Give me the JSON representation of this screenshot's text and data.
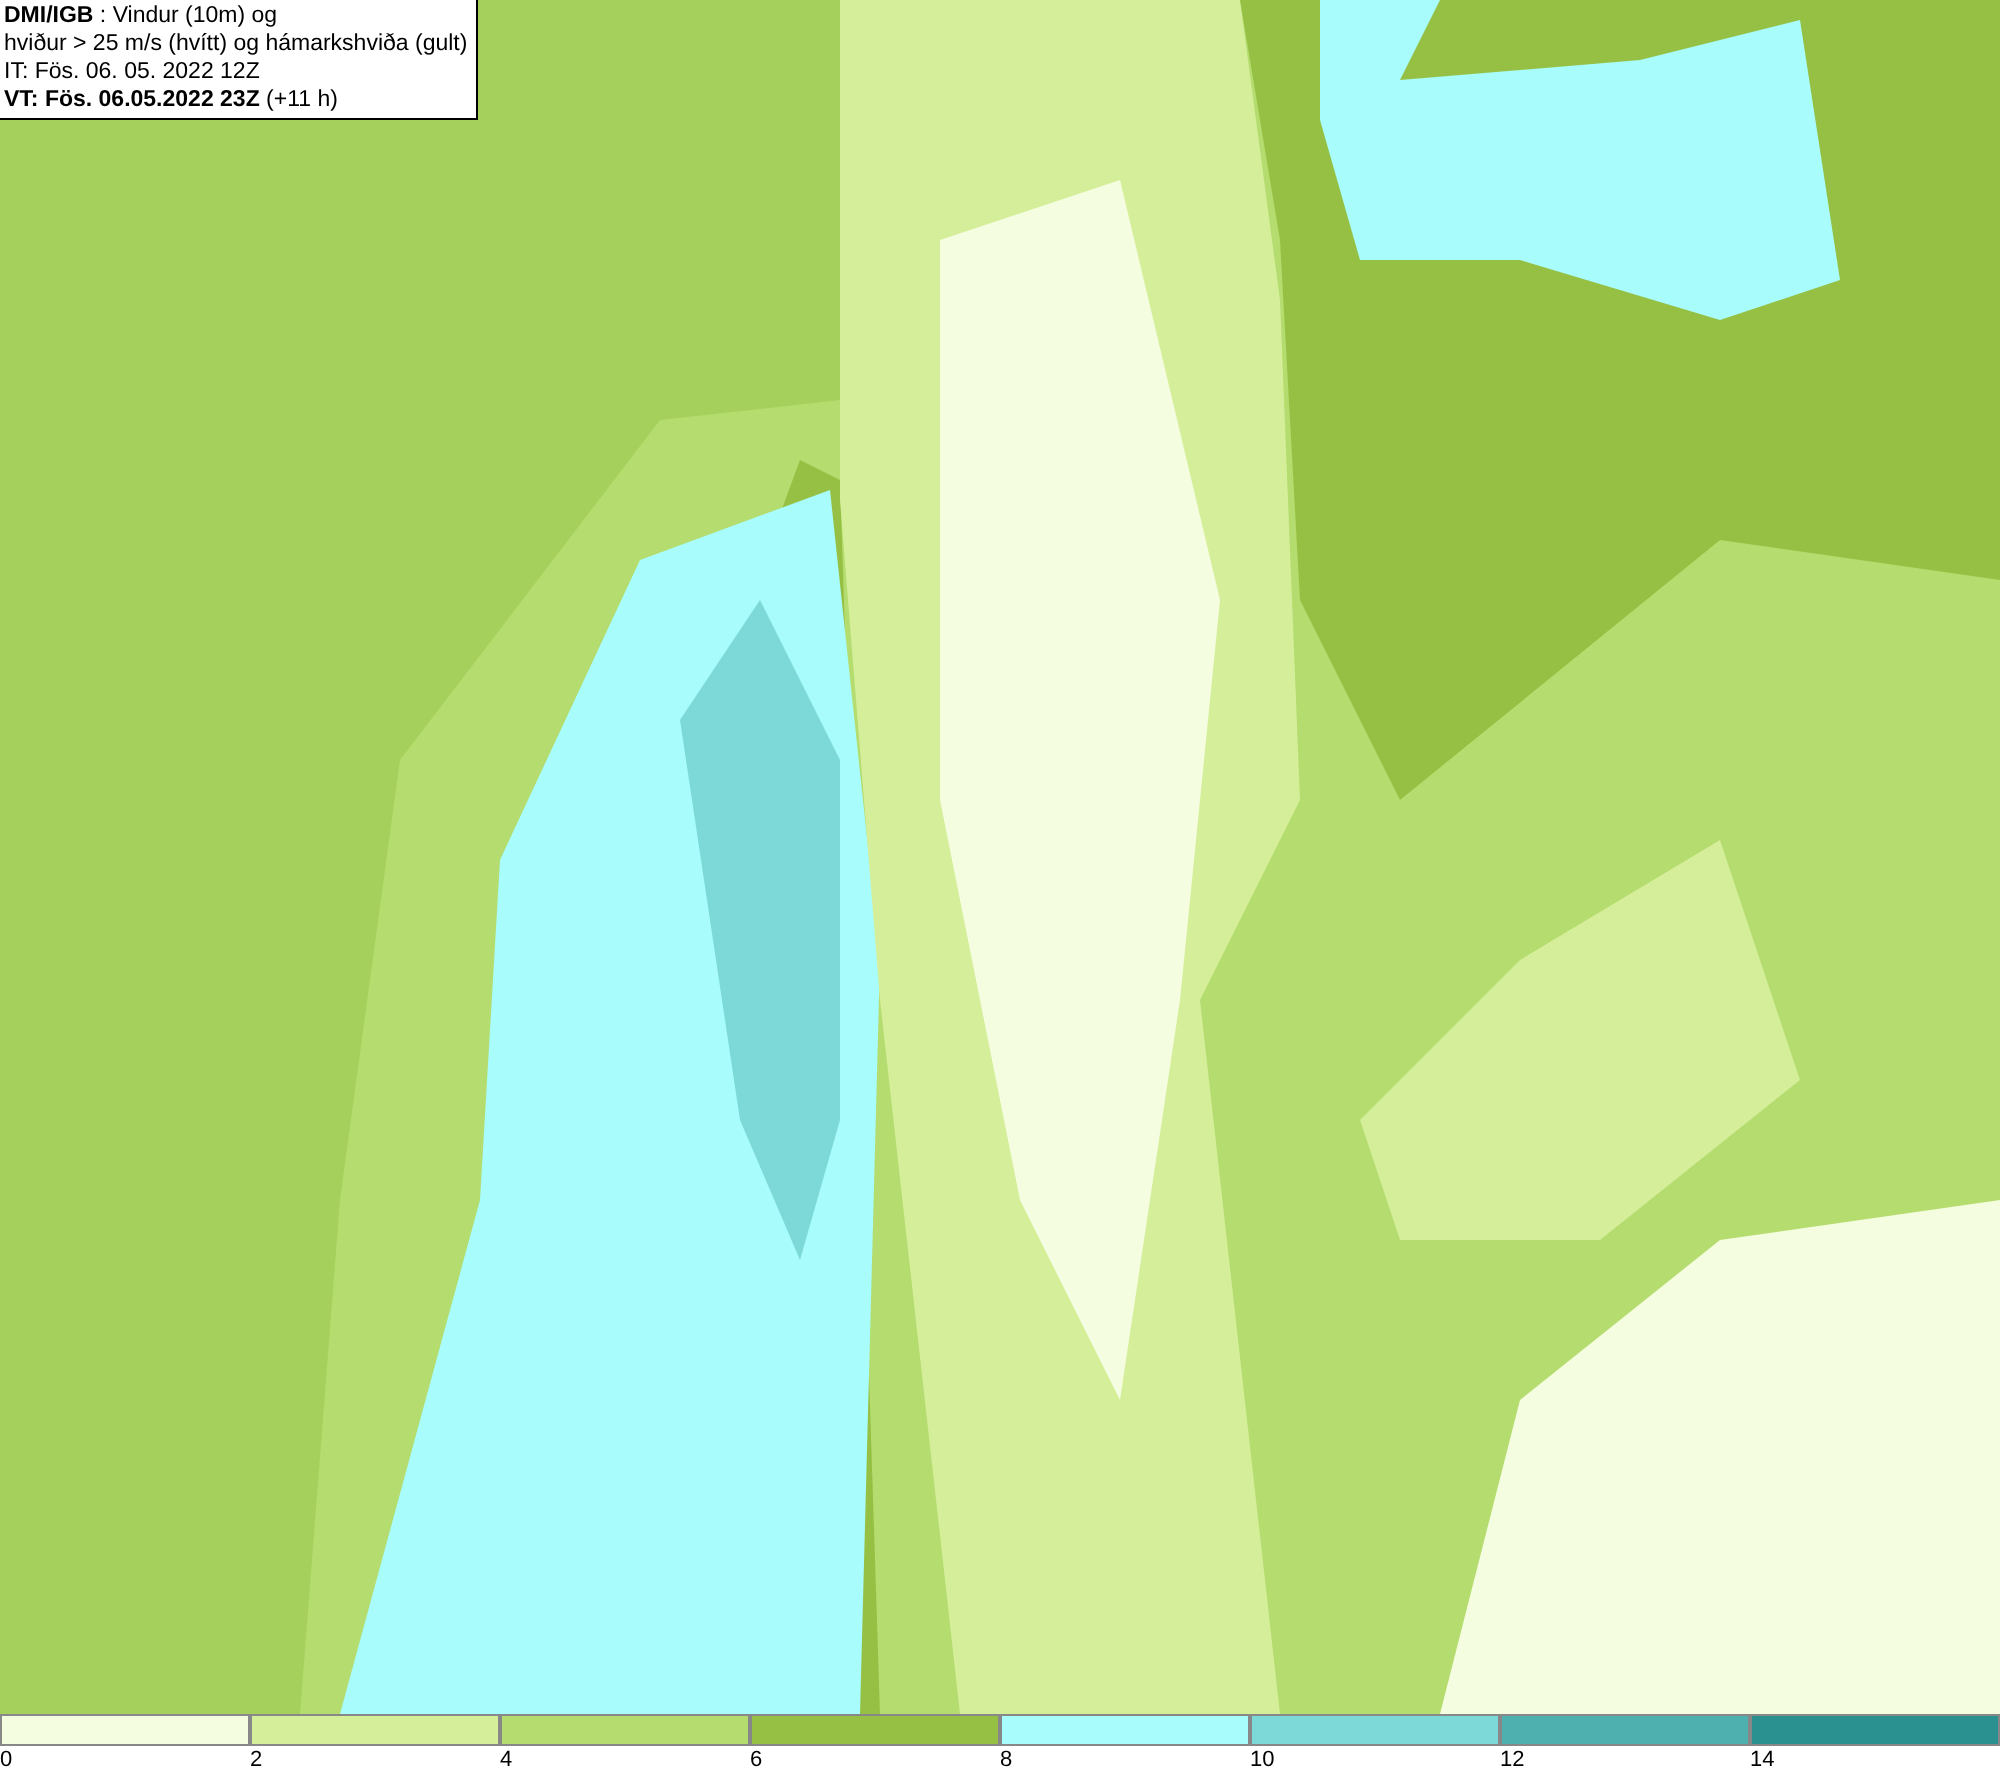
{
  "header": {
    "lines": [
      "**DMI/IGB** : Vindur (10m) og",
      "hviður > 25 m/s (hvítt) og hámarkshviða (gult)",
      "IT: Fös. 06. 05. 2022 12Z",
      "**VT: Fös. 06.05.2022 23Z** (+11 h)"
    ]
  },
  "legend": {
    "bins": [
      {
        "label": "0",
        "color": "#f5fde0"
      },
      {
        "label": "2",
        "color": "#d4ee9a"
      },
      {
        "label": "4",
        "color": "#b5dc6e"
      },
      {
        "label": "6",
        "color": "#96c043"
      },
      {
        "label": "8",
        "color": "#a8fcfc"
      },
      {
        "label": "10",
        "color": "#7dd8d8"
      },
      {
        "label": "12",
        "color": "#4fb0b0"
      },
      {
        "label": "14",
        "color": "#2a9090"
      }
    ]
  }
}
